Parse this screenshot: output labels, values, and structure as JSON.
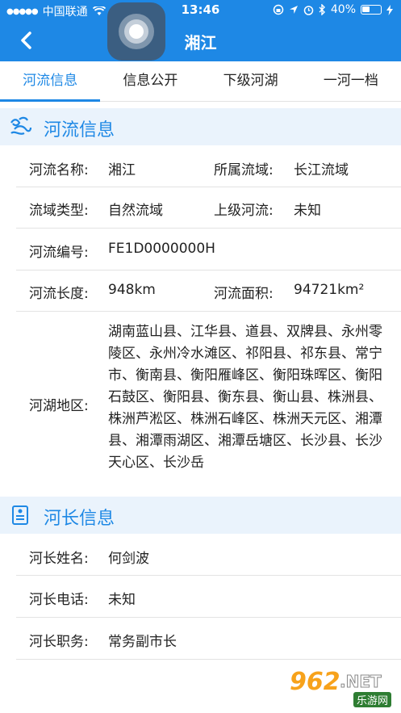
{
  "status_bar": {
    "carrier": "中国联通",
    "time": "13:46",
    "battery": "40%"
  },
  "nav": {
    "title": "湘江"
  },
  "tabs": [
    {
      "label": "河流信息"
    },
    {
      "label": "信息公开"
    },
    {
      "label": "下级河湖"
    },
    {
      "label": "一河一档"
    }
  ],
  "river_section": {
    "title": "河流信息",
    "river_name_label": "河流名称:",
    "river_name_value": "湘江",
    "basin_label": "所属流域:",
    "basin_value": "长江流域",
    "basin_type_label": "流域类型:",
    "basin_type_value": "自然流域",
    "upper_river_label": "上级河流:",
    "upper_river_value": "未知",
    "river_code_label": "河流编号:",
    "river_code_value": "FE1D0000000H",
    "length_label": "河流长度:",
    "length_value": "948km",
    "area_label": "河流面积:",
    "area_value": "94721km²",
    "region_label": "河湖地区:",
    "region_value": "湖南蓝山县、江华县、道县、双牌县、永州零陵区、永州冷水滩区、祁阳县、祁东县、常宁市、衡南县、衡阳雁峰区、衡阳珠晖区、衡阳石鼓区、衡阳县、衡东县、衡山县、株洲县、株洲芦淞区、株洲石峰区、株洲天元区、湘潭县、湘潭雨湖区、湘潭岳塘区、长沙县、长沙天心区、长沙岳"
  },
  "chief_section": {
    "title": "河长信息",
    "name_label": "河长姓名:",
    "name_value": "何剑波",
    "phone_label": "河长电话:",
    "phone_value": "未知",
    "position_label": "河长职务:",
    "position_value": "常务副市长"
  },
  "watermark": {
    "logo": "962",
    "net": ".NET",
    "sub": "乐游网"
  },
  "colors": {
    "brand_blue": "#1e88e5",
    "section_bg": "#eaf3fc",
    "divider": "#e3e3e3"
  }
}
